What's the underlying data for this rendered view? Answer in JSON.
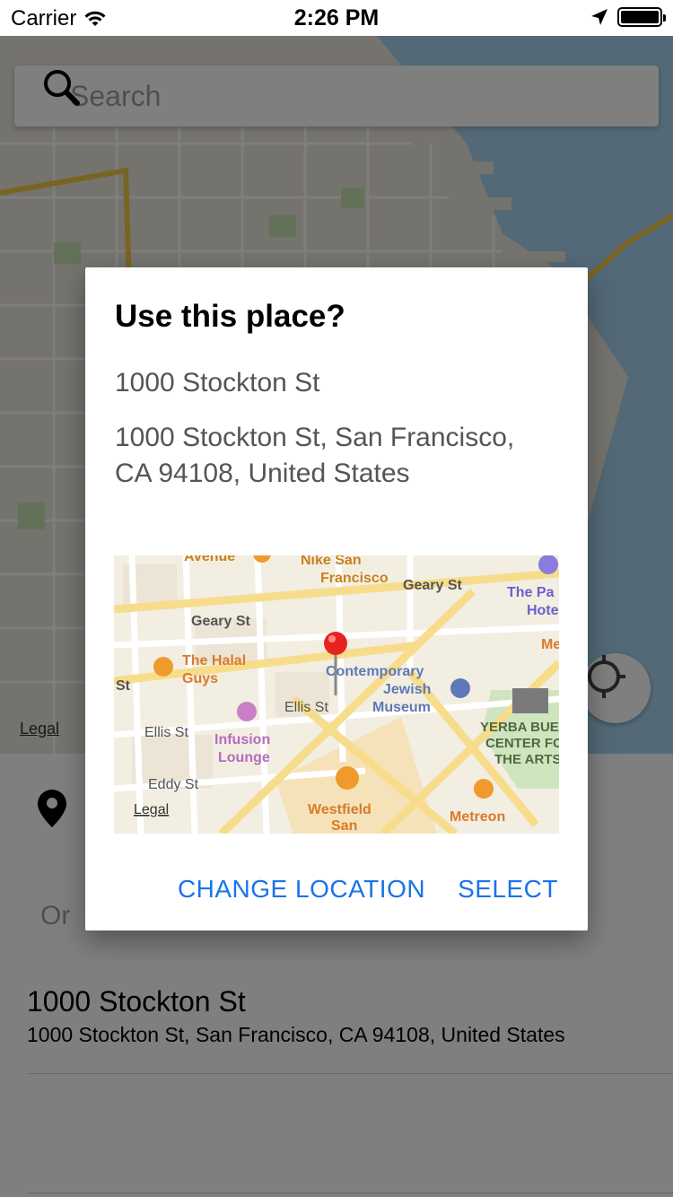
{
  "status_bar": {
    "carrier": "Carrier",
    "time": "2:26 PM",
    "wifi_icon": "wifi-icon",
    "location_icon": "location-arrow-icon",
    "battery_icon": "battery-icon"
  },
  "map": {
    "search_placeholder": "Search",
    "search_icon": "search-icon",
    "legal": "Legal",
    "locate_icon": "crosshair-icon",
    "water_color": "#a6d3ef",
    "road_color": "#f5c949"
  },
  "panel": {
    "pin_icon": "map-pin-icon",
    "or_text": "Or",
    "result": {
      "title": "1000 Stockton St",
      "subtitle": "1000 Stockton St, San Francisco, CA  94108, United States"
    }
  },
  "dialog": {
    "title": "Use this place?",
    "name": "1000 Stockton St",
    "address": "1000 Stockton St, San Francisco, CA  94108, United States",
    "change_button": "CHANGE LOCATION",
    "select_button": "SELECT",
    "accent_color": "#1a73e8",
    "map_labels": {
      "avenue": "Avenue",
      "nike": "Nike San\nFrancisco",
      "geary_st_1": "Geary St",
      "geary_st_2": "Geary St",
      "the_pa": "The Pa",
      "hote": "Hote",
      "me": "Me",
      "halal_guys": "The Halal\nGuys",
      "contemporary": "Contemporary\nJewish\nMuseum",
      "ellis_st_1": "Ellis St",
      "ellis_st_2": "Ellis St",
      "infusion": "Infusion\nLounge",
      "yerba": "YERBA BUE\nCENTER FO\nTHE ARTS",
      "eddy_st": "Eddy St",
      "westfield": "Westfield\nSan",
      "metreon": "Metreon",
      "legal": "Legal",
      "st_left": "St",
      "hst": "St"
    }
  }
}
